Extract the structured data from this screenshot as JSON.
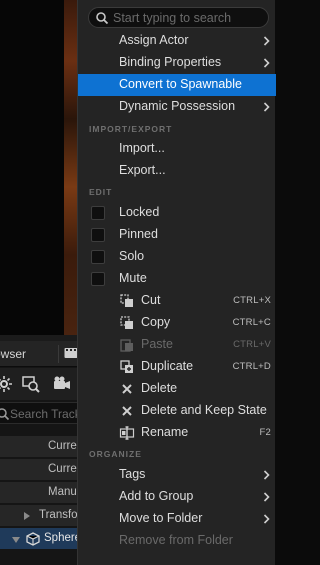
{
  "background": {
    "sequencer": {
      "tab_label": "owser",
      "search_placeholder": "Search Track",
      "tracks": [
        {
          "label": "Curren"
        },
        {
          "label": "Curren"
        },
        {
          "label": "Manu"
        },
        {
          "label": "Transfo"
        },
        {
          "label": "Sphere"
        }
      ]
    }
  },
  "menu": {
    "search": {
      "placeholder": "Start typing to search",
      "value": ""
    },
    "items_top": [
      {
        "label": "Assign Actor",
        "submenu": true
      },
      {
        "label": "Binding Properties",
        "submenu": true
      },
      {
        "label": "Convert to Spawnable",
        "highlighted": true
      },
      {
        "label": "Dynamic Possession",
        "submenu": true
      }
    ],
    "sections": {
      "import_export": "IMPORT/EXPORT",
      "edit": "EDIT",
      "organize": "ORGANIZE"
    },
    "import_export": [
      {
        "label": "Import..."
      },
      {
        "label": "Export..."
      }
    ],
    "toggles": [
      {
        "label": "Locked",
        "checked": false
      },
      {
        "label": "Pinned",
        "checked": false
      },
      {
        "label": "Solo",
        "checked": false
      },
      {
        "label": "Mute",
        "checked": false
      }
    ],
    "edit_actions": [
      {
        "label": "Cut",
        "shortcut": "CTRL+X",
        "icon": "cut-icon"
      },
      {
        "label": "Copy",
        "shortcut": "CTRL+C",
        "icon": "copy-icon"
      },
      {
        "label": "Paste",
        "shortcut": "CTRL+V",
        "icon": "paste-icon",
        "disabled": true
      },
      {
        "label": "Duplicate",
        "shortcut": "CTRL+D",
        "icon": "duplicate-icon"
      },
      {
        "label": "Delete",
        "shortcut": "",
        "icon": "delete-x-icon"
      },
      {
        "label": "Delete and Keep State",
        "shortcut": "",
        "icon": "delete-x-icon"
      },
      {
        "label": "Rename",
        "shortcut": "F2",
        "icon": "rename-icon"
      }
    ],
    "organize": [
      {
        "label": "Tags",
        "submenu": true
      },
      {
        "label": "Add to Group",
        "submenu": true
      },
      {
        "label": "Move to Folder",
        "submenu": true
      },
      {
        "label": "Remove from Folder",
        "disabled": true
      }
    ]
  },
  "colors": {
    "menu_bg": "#242424",
    "highlight": "#0e72d2",
    "text": "#dedede",
    "disabled_text": "#6a6a6a"
  }
}
